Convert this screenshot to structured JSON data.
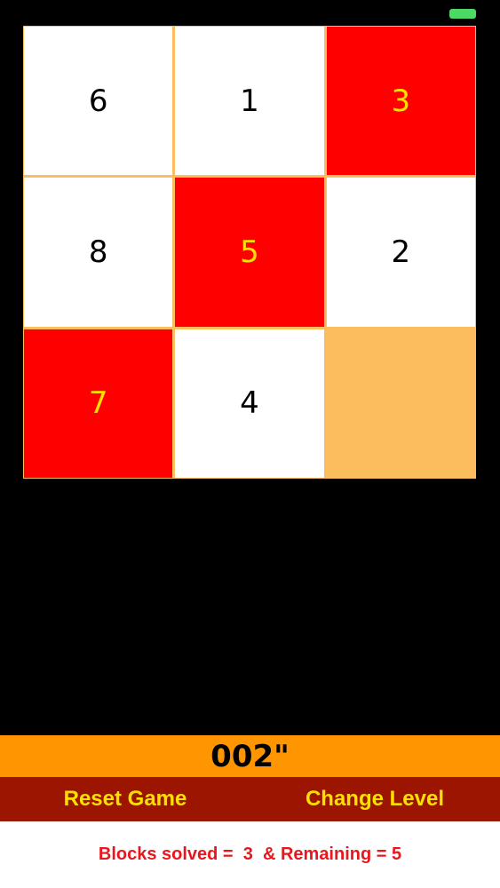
{
  "board": {
    "tiles": [
      {
        "label": "6",
        "style": "white"
      },
      {
        "label": "1",
        "style": "white"
      },
      {
        "label": "3",
        "style": "red"
      },
      {
        "label": "8",
        "style": "white"
      },
      {
        "label": "5",
        "style": "red"
      },
      {
        "label": "2",
        "style": "white"
      },
      {
        "label": "7",
        "style": "red"
      },
      {
        "label": "4",
        "style": "white"
      },
      {
        "label": "",
        "style": "empty"
      }
    ]
  },
  "timer": {
    "text": "002\""
  },
  "controls": {
    "reset_label": "Reset Game",
    "change_level_label": "Change Level"
  },
  "status": {
    "text": "Blocks solved =  3  & Remaining = 5"
  },
  "colors": {
    "solved_tile": "#ff0000",
    "unsolved_tile": "#ffffff",
    "empty_tile": "#fcbd5e",
    "timer_bar": "#ff9500",
    "button_bar": "#9c1500",
    "button_text": "#ffe000",
    "battery": "#4cd964"
  }
}
